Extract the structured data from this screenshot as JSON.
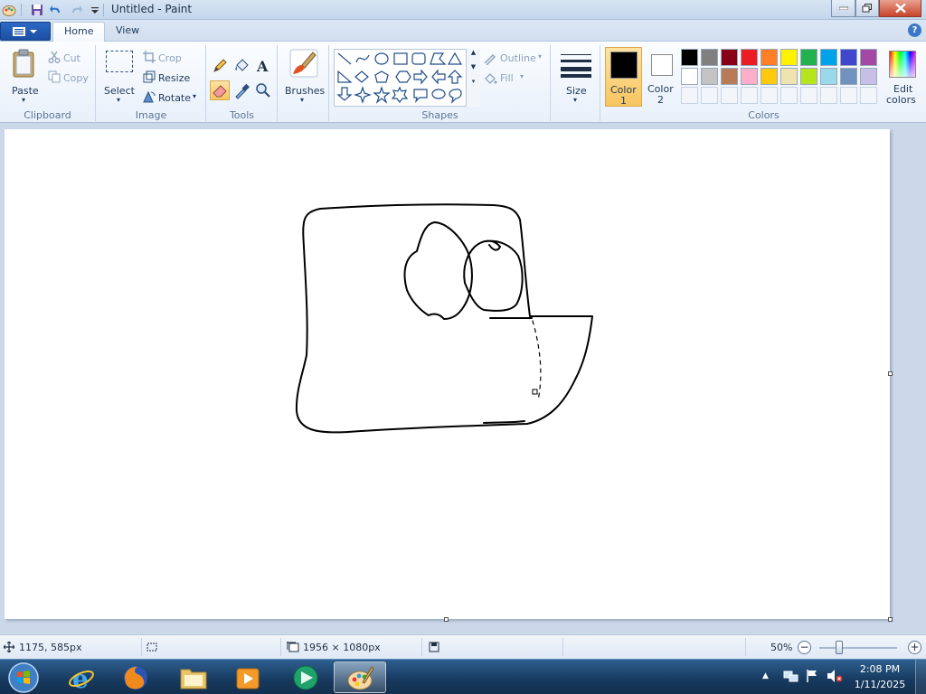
{
  "window": {
    "title": "Untitled - Paint"
  },
  "tabs": [
    {
      "label": "Home",
      "active": true
    },
    {
      "label": "View",
      "active": false
    }
  ],
  "ribbon": {
    "clipboard": {
      "group_label": "Clipboard",
      "paste": "Paste",
      "cut": "Cut",
      "copy": "Copy"
    },
    "image": {
      "group_label": "Image",
      "select": "Select",
      "crop": "Crop",
      "resize": "Resize",
      "rotate": "Rotate"
    },
    "tools": {
      "group_label": "Tools",
      "items": [
        "pencil-icon",
        "fill-icon",
        "text-icon",
        "eraser-icon",
        "color-picker-icon",
        "magnifier-icon"
      ]
    },
    "brushes": {
      "label": "Brushes"
    },
    "shapes": {
      "group_label": "Shapes",
      "outline": "Outline",
      "fill": "Fill"
    },
    "size": {
      "label": "Size"
    },
    "colors": {
      "group_label": "Colors",
      "color1_line1": "Color",
      "color1_line2": "1",
      "color2_line1": "Color",
      "color2_line2": "2",
      "edit_line1": "Edit",
      "edit_line2": "colors",
      "color1": "#000000",
      "color2": "#ffffff",
      "palette_row1": [
        "#000000",
        "#7f7f7f",
        "#880015",
        "#ed1c24",
        "#ff7f27",
        "#fff200",
        "#22b14c",
        "#00a2e8",
        "#3f48cc",
        "#a349a4"
      ],
      "palette_row2": [
        "#ffffff",
        "#c3c3c3",
        "#b97a57",
        "#ffaec9",
        "#ffc90e",
        "#efe4b0",
        "#b5e61d",
        "#99d9ea",
        "#7092be",
        "#c8bfe7"
      ]
    }
  },
  "statusbar": {
    "cursor_pos": "1175, 585px",
    "canvas_size": "1956 × 1080px",
    "zoom": "50%"
  },
  "taskbar": {
    "time": "2:08 PM",
    "date": "1/11/2025"
  }
}
